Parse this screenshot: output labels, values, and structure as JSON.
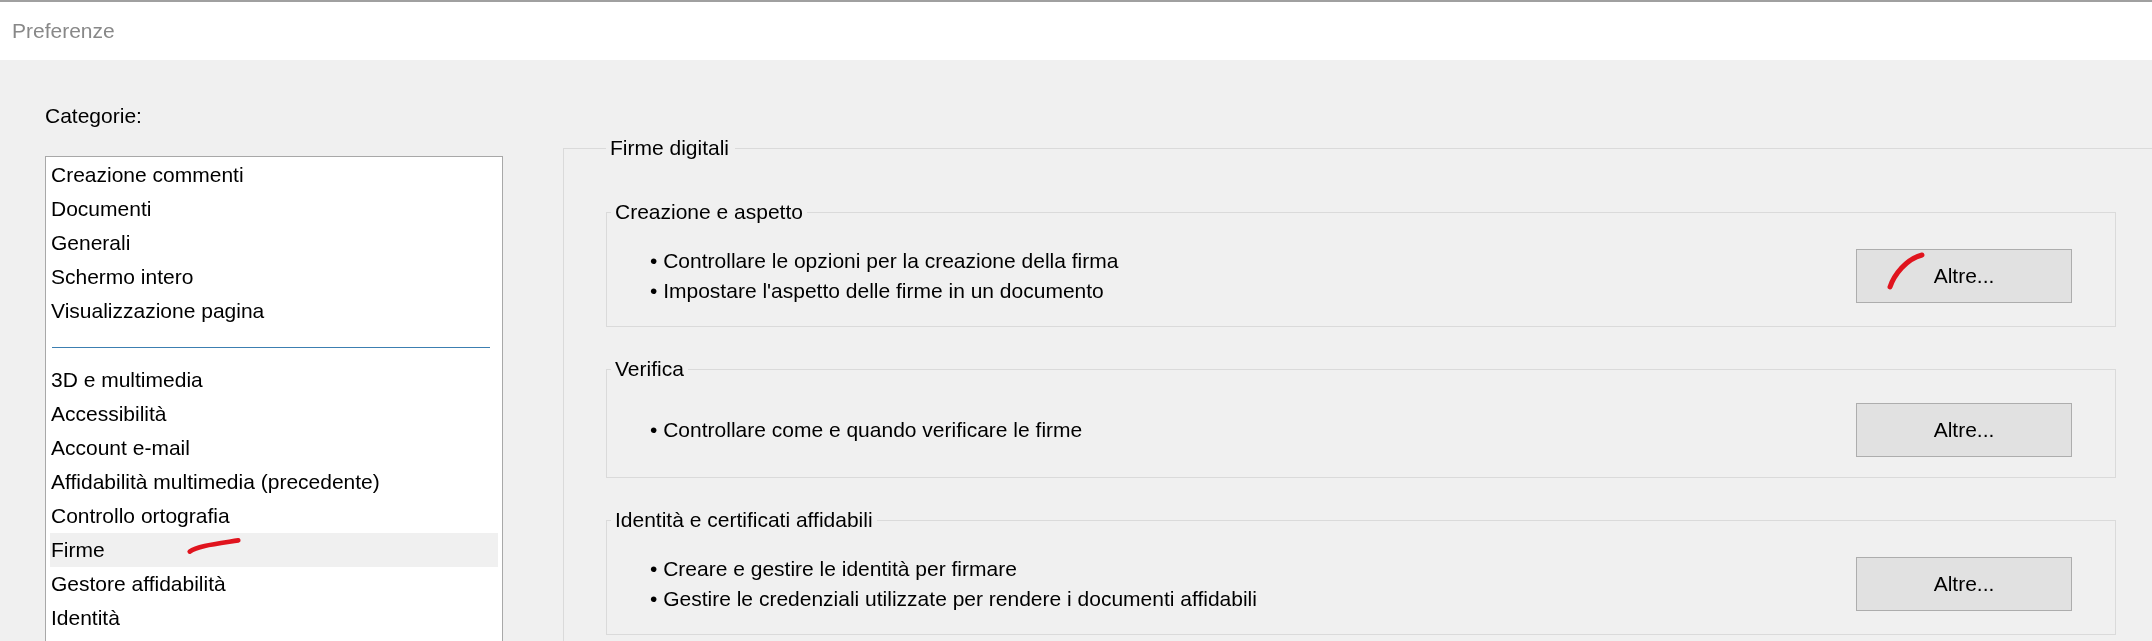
{
  "window": {
    "title": "Preferenze"
  },
  "categories": {
    "label": "Categorie:",
    "groups": [
      [
        {
          "label": "Creazione commenti",
          "selected": false
        },
        {
          "label": "Documenti",
          "selected": false
        },
        {
          "label": "Generali",
          "selected": false
        },
        {
          "label": "Schermo intero",
          "selected": false
        },
        {
          "label": "Visualizzazione pagina",
          "selected": false
        }
      ],
      [
        {
          "label": "3D e multimedia",
          "selected": false
        },
        {
          "label": "Accessibilità",
          "selected": false
        },
        {
          "label": "Account e-mail",
          "selected": false
        },
        {
          "label": "Affidabilità multimedia (precedente)",
          "selected": false
        },
        {
          "label": "Controllo ortografia",
          "selected": false
        },
        {
          "label": "Firme",
          "selected": true
        },
        {
          "label": "Gestore affidabilità",
          "selected": false
        },
        {
          "label": "Identità",
          "selected": false
        }
      ]
    ]
  },
  "panel": {
    "title": "Firme digitali",
    "sections": [
      {
        "title": "Creazione e aspetto",
        "bullets": [
          "• Controllare le opzioni per la creazione della firma",
          "• Impostare l'aspetto delle firme in un documento"
        ],
        "button": "Altre..."
      },
      {
        "title": "Verifica",
        "bullets": [
          "• Controllare come e quando verificare le firme"
        ],
        "button": "Altre..."
      },
      {
        "title": "Identità e certificati affidabili",
        "bullets": [
          "• Creare e gestire le identità per firmare",
          "• Gestire le credenziali utilizzate per rendere i documenti affidabili"
        ],
        "button": "Altre..."
      }
    ]
  }
}
